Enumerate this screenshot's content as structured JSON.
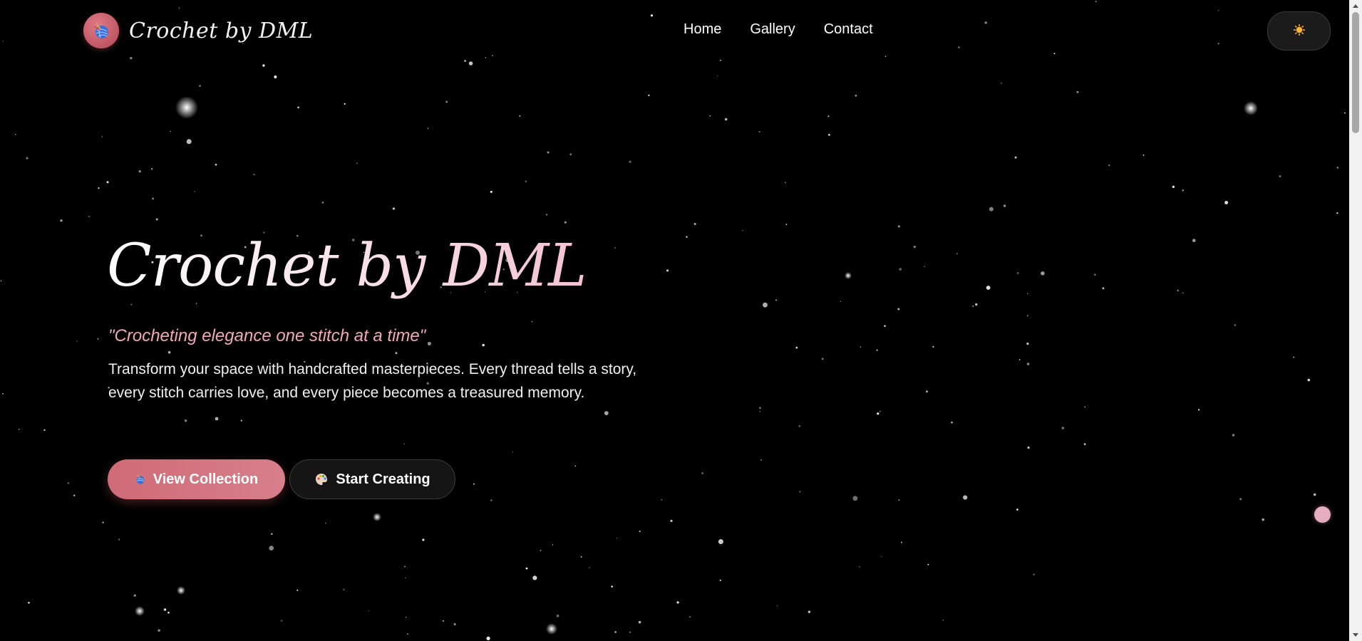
{
  "nav": {
    "brand": "Crochet by DML",
    "links": [
      "Home",
      "Gallery",
      "Contact"
    ],
    "theme_toggle_icon": "sun-icon"
  },
  "hero": {
    "title": "Crochet by DML",
    "tagline": "\"Crocheting elegance one stitch at a time\"",
    "description": "Transform your space with handcrafted masterpieces. Every thread tells a story, every stitch carries love, and every piece becomes a treasured memory.",
    "primary_button": "View Collection",
    "primary_icon": "yarn-ball-icon",
    "secondary_button": "Start Creating",
    "secondary_icon": "palette-icon"
  },
  "colors": {
    "background": "#000000",
    "accent": "#cf6b76",
    "tagline": "#f2a7bd",
    "floating_dot": "#e4aec0"
  }
}
